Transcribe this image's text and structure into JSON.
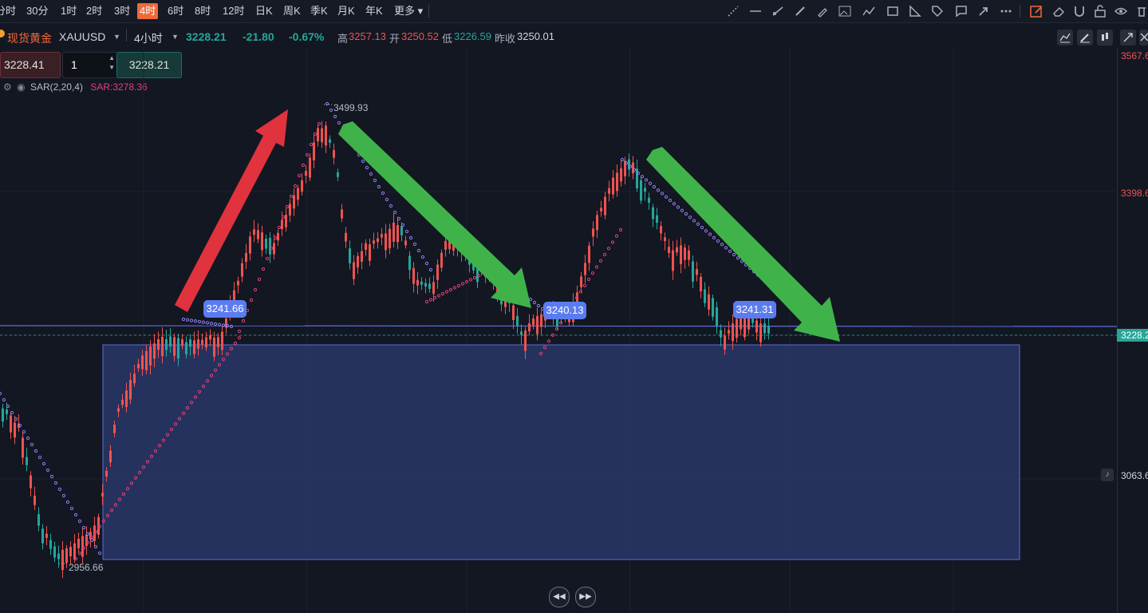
{
  "toolbar": {
    "timeframes": [
      "分时",
      "30分",
      "1时",
      "2时",
      "3时",
      "4时",
      "6时",
      "8时",
      "12时",
      "日K",
      "周K",
      "季K",
      "月K",
      "年K",
      "更多"
    ],
    "active_timeframe": "4时"
  },
  "symbol": {
    "name": "现货黄金",
    "code": "XAUUSD",
    "interval": "4小时",
    "price": "3228.21",
    "change": "-21.80",
    "change_pct": "-0.67%",
    "high_label": "高",
    "high": "3257.13",
    "open_label": "开",
    "open": "3250.52",
    "low_label": "低",
    "low": "3226.59",
    "prev_close_label": "昨收",
    "prev_close": "3250.01"
  },
  "trade": {
    "sell_price": "3228.41",
    "quantity": "1",
    "buy_price": "3228.21"
  },
  "indicator": {
    "name": "SAR(2,20,4)",
    "value_label": "SAR:3278.36"
  },
  "price_axis": {
    "top_label": "3567.6",
    "mid_label": "3398.6",
    "current_label": "3228.2",
    "lower_label": "3063.6"
  },
  "annotations": {
    "peak_label": "3499.93",
    "trough_label": "2956.66",
    "bubble_left": "3241.66",
    "bubble_mid": "3240.13",
    "bubble_right": "3241.31"
  },
  "colors": {
    "up": "#ef5350",
    "down": "#26a69a",
    "background": "#131722",
    "accent": "#f0693b",
    "box": "#2a3a6e",
    "bubble": "#5b7cf0"
  }
}
